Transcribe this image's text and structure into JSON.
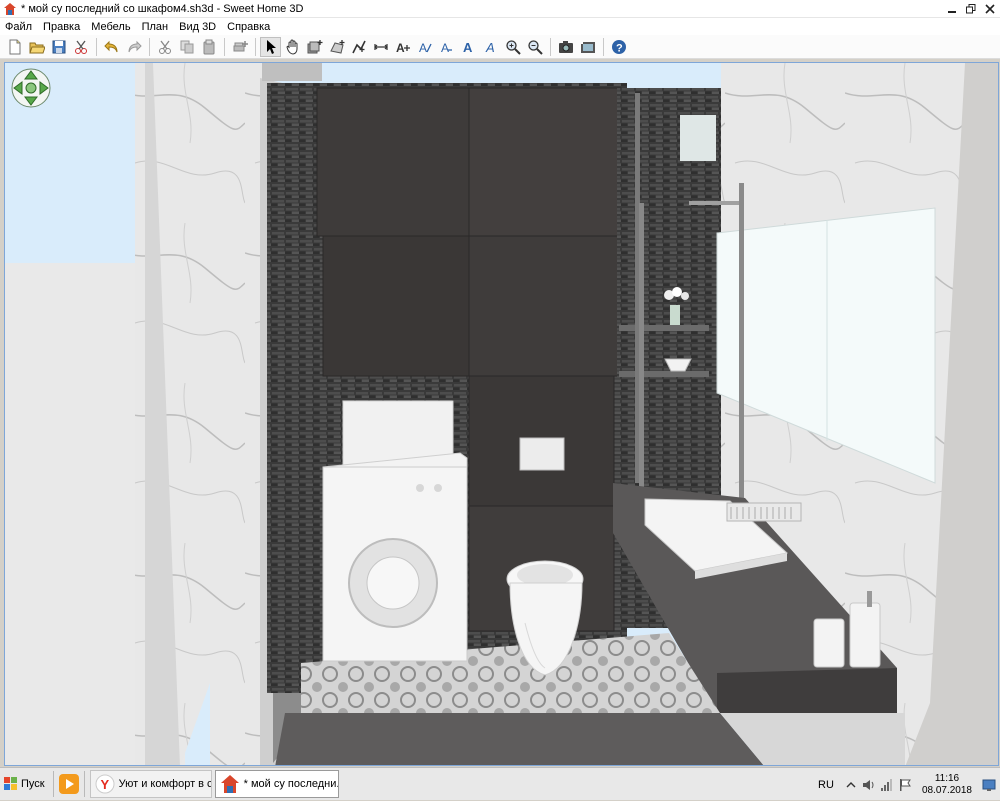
{
  "window": {
    "title": "* мой су последний со шкафом4.sh3d - Sweet Home 3D",
    "icon": "sweet-home-3d-icon",
    "controls": [
      "minimize-icon",
      "maximize-icon",
      "close-icon"
    ]
  },
  "menu": {
    "items": [
      {
        "label": "Файл"
      },
      {
        "label": "Правка"
      },
      {
        "label": "Мебель"
      },
      {
        "label": "План"
      },
      {
        "label": "Вид 3D"
      },
      {
        "label": "Справка"
      }
    ]
  },
  "toolbar": {
    "groups": [
      [
        "new-home-icon",
        "open-icon",
        "save-icon",
        "cut-all-icon"
      ],
      [
        "undo-icon",
        "redo-icon"
      ],
      [
        "cut-icon",
        "copy-icon",
        "paste-icon"
      ],
      [
        "add-furniture-icon"
      ],
      [
        "select-arrow-icon",
        "pan-hand-icon",
        "create-walls-icon",
        "create-rooms-icon",
        "create-polylines-icon",
        "create-dimensions-icon",
        "add-text-icon",
        "modify-text-style-icon",
        "text-bold-icon",
        "text-italic-icon",
        "increase-text-size-icon",
        "decrease-text-size-icon",
        "zoom-in-icon",
        "zoom-out-icon"
      ],
      [
        "create-photo-icon",
        "create-video-icon"
      ],
      [
        "help-icon"
      ]
    ]
  },
  "view3d": {
    "navigation": "navigation-arrows-icon",
    "colors": {
      "sky": "#d9ecfb",
      "ground": "#e9e9e9",
      "dark_tile": "#3e3b3a",
      "marble": "#e6e6e6"
    }
  },
  "taskbar": {
    "start_label": "Пуск",
    "quick_launch": [
      "media-player-icon"
    ],
    "tasks": [
      {
        "label": "Уют и комфорт в с...",
        "icon": "yandex-browser-icon",
        "active": false
      },
      {
        "label": "* мой су последни...",
        "icon": "sweet-home-3d-icon",
        "active": true
      }
    ],
    "language": "RU",
    "tray_icons": [
      "chevron-up-icon",
      "speaker-icon",
      "network-icon",
      "flag-icon"
    ],
    "time": "11:16",
    "date": "08.07.2018"
  }
}
